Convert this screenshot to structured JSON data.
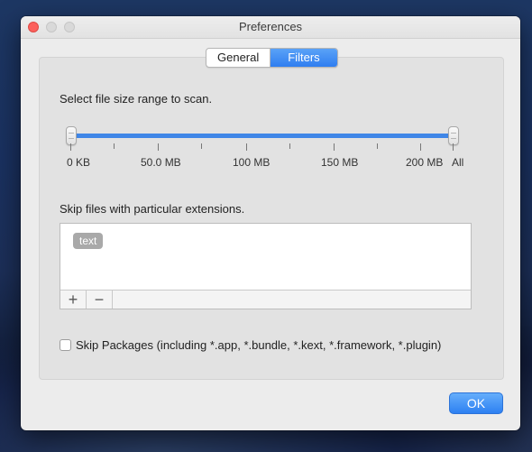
{
  "window": {
    "title": "Preferences"
  },
  "tabs": [
    {
      "label": "General",
      "active": false
    },
    {
      "label": "Filters",
      "active": true
    }
  ],
  "size_range": {
    "label": "Select file size range to scan.",
    "ticks": [
      "0 KB",
      "50.0 MB",
      "100 MB",
      "150 MB",
      "200 MB",
      "All"
    ],
    "selected_min": "0 KB",
    "selected_max": "All"
  },
  "extensions": {
    "label": "Skip files with particular extensions.",
    "items": [
      "text"
    ],
    "add_icon": "plus-icon",
    "remove_icon": "minus-icon"
  },
  "packages": {
    "label": "Skip Packages (including *.app, *.bundle, *.kext, *.framework, *.plugin)",
    "checked": false
  },
  "ok_label": "OK",
  "colors": {
    "accent": "#3f86e7",
    "close_button": "#fc605c",
    "tag": "#a9a9a9"
  }
}
